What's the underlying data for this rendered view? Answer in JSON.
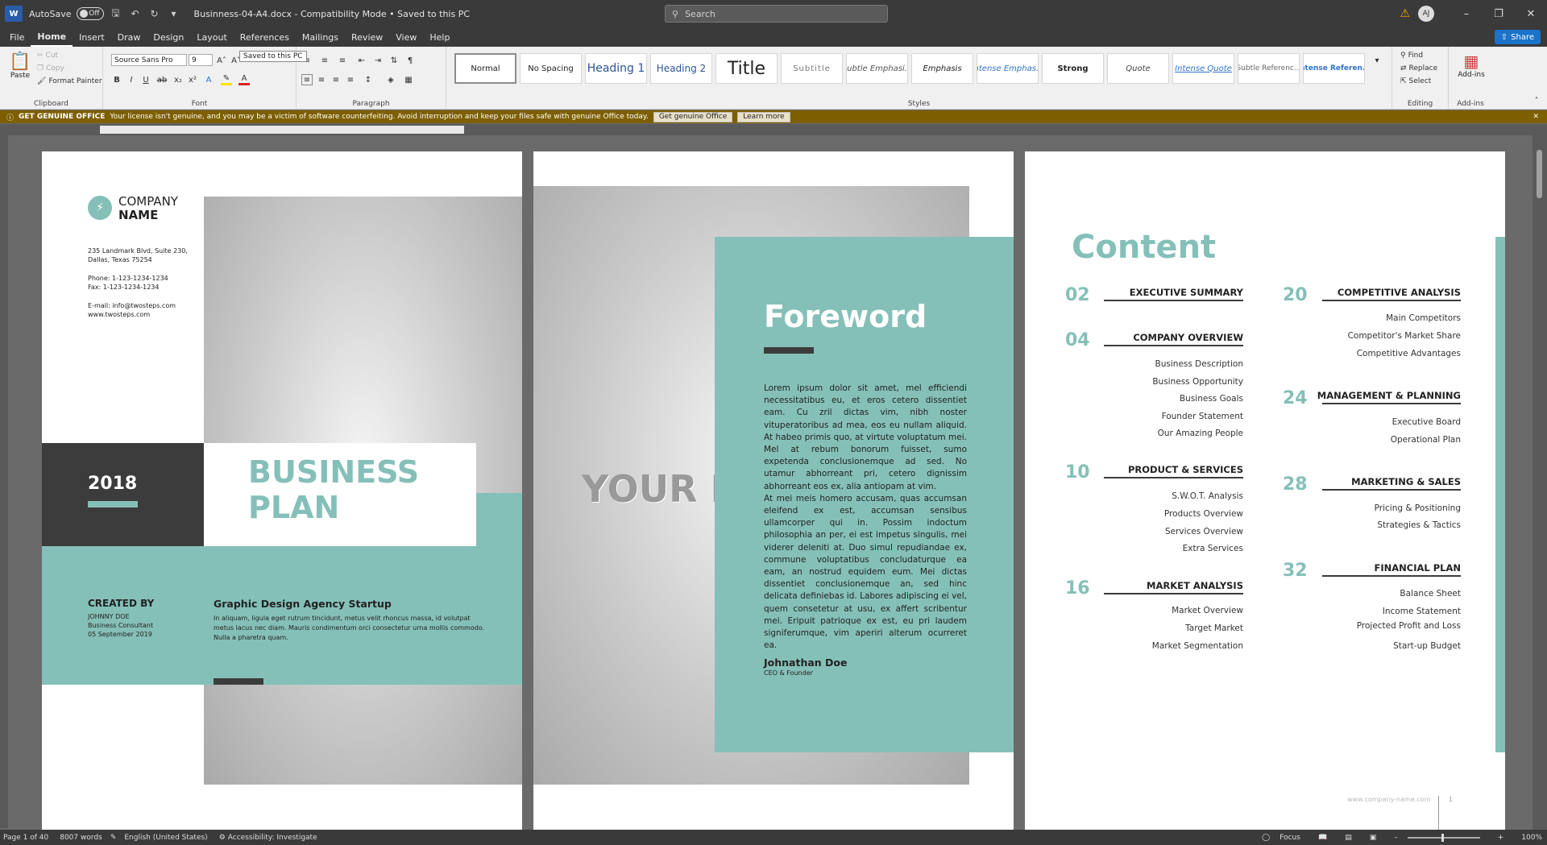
{
  "titlebar": {
    "app_icon": "W",
    "autosave_label": "AutoSave",
    "autosave_state": "Off",
    "doc_title": "Businness-04-A4.docx  -  Compatibility Mode  •  Saved to this PC",
    "search_placeholder": "Search",
    "avatar_initials": "AJ"
  },
  "menu": {
    "tabs": [
      "File",
      "Home",
      "Insert",
      "Draw",
      "Design",
      "Layout",
      "References",
      "Mailings",
      "Review",
      "View",
      "Help"
    ],
    "active": "Home",
    "share": "Share"
  },
  "ribbon": {
    "clipboard": {
      "paste": "Paste",
      "cut": "Cut",
      "copy": "Copy",
      "format_painter": "Format Painter",
      "label": "Clipboard"
    },
    "font": {
      "name": "Source Sans Pro",
      "size": "9",
      "label": "Font"
    },
    "paragraph_label": "Paragraph",
    "styles": [
      "Normal",
      "No Spacing",
      "Heading 1",
      "Heading 2",
      "Title",
      "Subtitle",
      "Subtle Emphasi...",
      "Emphasis",
      "Intense Emphas...",
      "Strong",
      "Quote",
      "Intense Quote",
      "Subtle Referenc...",
      "Intense Referen..."
    ],
    "styles_label": "Styles",
    "editing": {
      "find": "Find",
      "replace": "Replace",
      "select": "Select",
      "label": "Editing"
    },
    "addins": {
      "button": "Add-ins",
      "label": "Add-ins"
    },
    "tooltip": "Saved to this PC"
  },
  "license_bar": {
    "title": "GET GENUINE OFFICE",
    "message": "Your license isn't genuine, and you may be a victim of software counterfeiting. Avoid interruption and keep your files safe with genuine Office today.",
    "btn_genuine": "Get genuine Office",
    "btn_learn": "Learn more"
  },
  "page1": {
    "company_line1": "COMPANY",
    "company_line2": "NAME",
    "address1": "235 Landmark Blvd, Suite 230,",
    "address2": "Dallas, Texas 75254",
    "phone": "Phone: 1-123-1234-1234",
    "fax": "Fax: 1-123-1234-1234",
    "email": "E-mail: info@twosteps.com",
    "web": "www.twosteps.com",
    "year": "2018",
    "title1": "BUSINESS",
    "title2": "PLAN",
    "created_by": "CREATED BY",
    "author": "JOHNNY DOE",
    "author_role": "Business Consultant",
    "date": "05 September 2019",
    "agency": "Graphic Design Agency Startup",
    "agency_text": "In aliquam, ligula eget rutrum tincidunt, metus velit rhoncus massa, id volutpat metus lacus nec diam. Mauris condimentum orci consectetur urna mollis commodo. Nulla a pharetra quam."
  },
  "page2": {
    "image_placeholder": "YOUR IMAGE",
    "heading": "Foreword",
    "para1": "Lorem ipsum dolor sit amet, mel efficiendi necessitatibus eu, et eros cetero dissentiet eam. Cu zril dictas vim, nibh noster vituperatoribus ad mea, eos eu nullam aliquid. At habeo primis quo, at virtute voluptatum mei. Mel at rebum bonorum fuisset, sumo expetenda conclusionemque ad sed. No utamur abhorreant pri, cetero dignissim abhorreant eos ex, alia antiopam at vim.",
    "para2": "At mei meis homero accusam, quas accumsan eleifend ex est, accumsan sensibus ullamcorper qui in. Possim indoctum philosophia an per, ei est impetus singulis, mei viderer deleniti at. Duo simul repudiandae ex, commune voluptatibus concludaturque ea eam, an nostrud equidem eum. Mei dictas dissentiet conclusionemque an, sed hinc delicata definiebas id. Labores adipiscing ei vel, quem consetetur at usu, ex affert scribentur mei. Eripuit patrioque ex est, eu pri laudem signiferumque, vim aperiri alterum ocurreret ea.",
    "signer": "Johnathan Doe",
    "signer_role": "CEO & Founder"
  },
  "page3": {
    "heading": "Content",
    "sections_left": [
      {
        "num": "02",
        "title": "EXECUTIVE SUMMARY",
        "items": []
      },
      {
        "num": "04",
        "title": "COMPANY OVERVIEW",
        "items": [
          "Business Description",
          "Business Opportunity",
          "Business Goals",
          "Founder Statement",
          "Our Amazing People"
        ]
      },
      {
        "num": "10",
        "title": "PRODUCT & SERVICES",
        "items": [
          "S.W.O.T. Analysis",
          "Products Overview",
          "Services Overview",
          "Extra Services"
        ]
      },
      {
        "num": "16",
        "title": "MARKET ANALYSIS",
        "items": [
          "Market Overview",
          "Target Market",
          "Market Segmentation"
        ]
      }
    ],
    "sections_right": [
      {
        "num": "20",
        "title": "COMPETITIVE ANALYSIS",
        "items": [
          "Main Competitors",
          "Competitor's Market Share",
          "Competitive Advantages"
        ]
      },
      {
        "num": "24",
        "title": "MANAGEMENT & PLANNING",
        "items": [
          "Executive Board",
          "Operational Plan"
        ]
      },
      {
        "num": "28",
        "title": "MARKETING & SALES",
        "items": [
          "Pricing & Positioning",
          "Strategies & Tactics"
        ]
      },
      {
        "num": "32",
        "title": "FINANCIAL PLAN",
        "items": [
          "Balance Sheet",
          "Income Statement",
          "Projected Profit and Loss",
          "Start-up Budget"
        ]
      }
    ],
    "footer_web": "www.company-name.com",
    "page_no": "1"
  },
  "status": {
    "page": "Page 1 of 40",
    "words": "8007 words",
    "language": "English (United States)",
    "accessibility": "Accessibility: Investigate",
    "focus": "Focus",
    "zoom": "100%"
  },
  "colors": {
    "accent": "#85c0b8",
    "dark": "#3c3c3c",
    "license_bar": "#7d5f00"
  }
}
